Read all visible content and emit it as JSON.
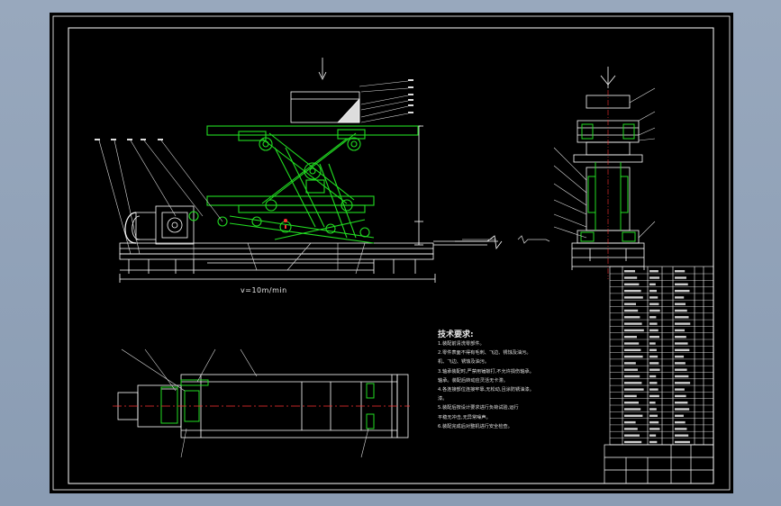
{
  "drawing": {
    "speed_label": "v=10m/min",
    "tech_requirements_title": "技术要求:",
    "tech_notes": [
      "1.装配前清洗零部件。",
      "2.零件表面不得有毛刺、飞边、锈蚀及油污。",
      "   机、飞边、锈蚀及油污。",
      "3.轴承装配时,严禁用锤敲打,不允许损伤轴承。",
      "   轴承。装配后转动应灵活无卡滞。",
      "4.各连接部位连接牢靠,无松动,且涂防锈油漆。",
      "   漆。",
      "5.装配后按设计要求进行负荷试验,运行",
      "   平稳无冲击,无异常噪声。",
      "6.装配完成后对整机进行安全检查。"
    ]
  },
  "colors": {
    "background": "#8e9fb5",
    "sheet": "#000000",
    "lines": "#ffffff",
    "mechanism": "#22dd22",
    "leaders": "#dddddd",
    "centerline": "#ff3030"
  }
}
